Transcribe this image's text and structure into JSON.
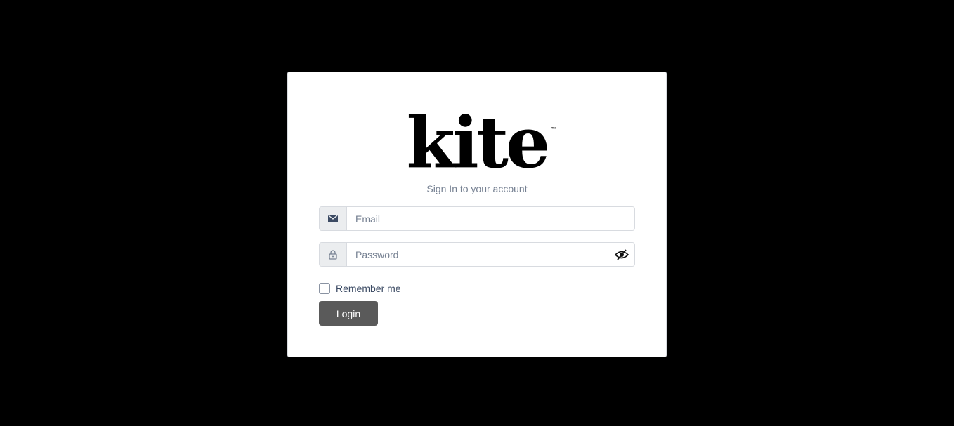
{
  "brand": {
    "logo_text": "kite",
    "trademark": "™"
  },
  "subtitle": "Sign In to your account",
  "email": {
    "placeholder": "Email",
    "value": "",
    "icon": "envelope-icon"
  },
  "password": {
    "placeholder": "Password",
    "value": "",
    "icon": "lock-icon",
    "toggle_icon": "eye-slash-icon"
  },
  "remember": {
    "label": "Remember me",
    "checked": false
  },
  "login_button": {
    "label": "Login"
  },
  "colors": {
    "background": "#000000",
    "card": "#ffffff",
    "button": "#5a5a5a",
    "muted_text": "#768192",
    "input_addon": "#ebedef"
  }
}
